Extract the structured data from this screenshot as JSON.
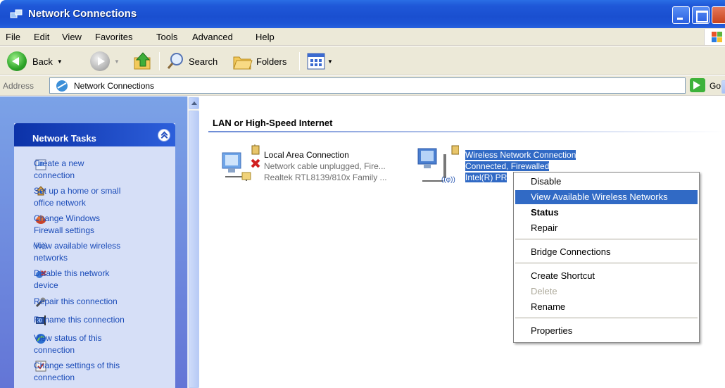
{
  "window": {
    "title": "Network Connections"
  },
  "menubar": {
    "items": [
      "File",
      "Edit",
      "View",
      "Favorites",
      "Tools",
      "Advanced",
      "Help"
    ]
  },
  "toolbar": {
    "back_label": "Back",
    "search_label": "Search",
    "folders_label": "Folders"
  },
  "address": {
    "label": "Address",
    "value": "Network Connections",
    "go_label": "Go"
  },
  "tasks": {
    "title": "Network Tasks",
    "items": [
      {
        "line1": "Create a new",
        "line2": "connection",
        "icon": "new-connection-icon"
      },
      {
        "line1": "Set up a home or small",
        "line2": "office network",
        "icon": "home-network-icon"
      },
      {
        "line1": "Change Windows",
        "line2": "Firewall settings",
        "icon": "firewall-icon"
      },
      {
        "line1": "View available wireless",
        "line2": "networks",
        "icon": "wireless-icon"
      },
      {
        "line1": "Disable this network",
        "line2": "device",
        "icon": "disable-device-icon"
      },
      {
        "line1": "Repair this connection",
        "line2": "",
        "icon": "repair-icon"
      },
      {
        "line1": "Rename this connection",
        "line2": "",
        "icon": "rename-icon"
      },
      {
        "line1": "View status of this",
        "line2": "connection",
        "icon": "status-icon"
      },
      {
        "line1": "Change settings of this",
        "line2": "connection",
        "icon": "settings-icon"
      }
    ]
  },
  "main": {
    "group_title": "LAN or High-Speed Internet",
    "connections": [
      {
        "name": "Local Area Connection",
        "status": "Network cable unplugged, Fire...",
        "device": "Realtek RTL8139/810x Family ..."
      },
      {
        "name": "Wireless Network Connection",
        "status": "Connected, Firewalled",
        "device": "Intel(R) PR",
        "signal_glyph": "((φ))"
      }
    ]
  },
  "context_menu": {
    "items": [
      {
        "label": "Disable",
        "state": "normal"
      },
      {
        "label": "View Available Wireless Networks",
        "state": "highlighted"
      },
      {
        "label": "Status",
        "state": "bold"
      },
      {
        "label": "Repair",
        "state": "normal"
      },
      {
        "label": "Bridge Connections",
        "state": "normal"
      },
      {
        "label": "Create Shortcut",
        "state": "normal"
      },
      {
        "label": "Delete",
        "state": "disabled"
      },
      {
        "label": "Rename",
        "state": "normal"
      },
      {
        "label": "Properties",
        "state": "normal"
      }
    ]
  },
  "colors": {
    "titlebar": "#1f58d8",
    "selection": "#316ac5",
    "task_link": "#1a4bb8",
    "task_header": "#0c32a8"
  }
}
